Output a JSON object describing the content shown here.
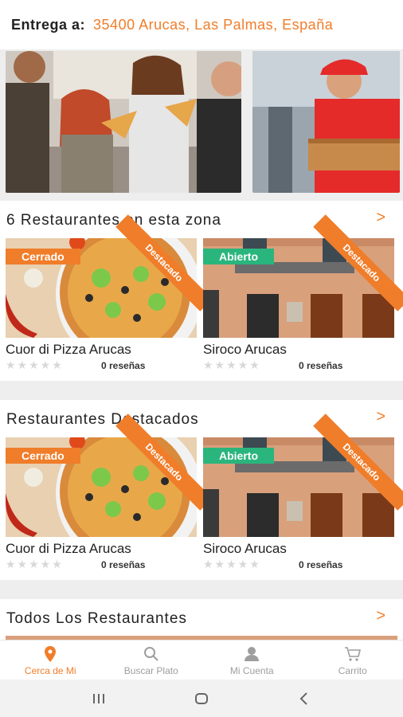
{
  "header": {
    "label": "Entrega a:",
    "address": "35400 Arucas, Las Palmas, España"
  },
  "banners": [
    {
      "icon": "friends-eating-pizza-photo"
    },
    {
      "icon": "pizza-delivery-man-photo"
    }
  ],
  "sections": [
    {
      "title": "6 Restaurantes en esta zona",
      "arrow": ">",
      "cards": [
        {
          "name": "Cuor di Pizza Arucas",
          "status": "Cerrado",
          "ribbon": "Destacado",
          "stars": "★★★★★",
          "reviews": "0 reseñas",
          "rating": 0
        },
        {
          "name": "Siroco Arucas",
          "status": "Abierto",
          "ribbon": "Destacado",
          "stars": "★★★★★",
          "reviews": "0 reseñas",
          "rating": 0
        }
      ]
    },
    {
      "title": "Restaurantes Destacados",
      "arrow": ">",
      "cards": [
        {
          "name": "Cuor di Pizza Arucas",
          "status": "Cerrado",
          "ribbon": "Destacado",
          "stars": "★★★★★",
          "reviews": "0 reseñas",
          "rating": 0
        },
        {
          "name": "Siroco Arucas",
          "status": "Abierto",
          "ribbon": "Destacado",
          "stars": "★★★★★",
          "reviews": "0 reseñas",
          "rating": 0
        }
      ]
    },
    {
      "title": "Todos Los Restaurantes",
      "arrow": ">"
    }
  ],
  "bottom_nav": [
    {
      "label": "Cerca de Mi",
      "icon": "location-pin-icon",
      "active": true
    },
    {
      "label": "Buscar Plato",
      "icon": "search-icon",
      "active": false
    },
    {
      "label": "Mi Cuenta",
      "icon": "user-icon",
      "active": false
    },
    {
      "label": "Carrito",
      "icon": "cart-icon",
      "active": false
    }
  ],
  "colors": {
    "accent": "#f07d2a",
    "open": "#2ab57d",
    "closed": "#f07d2a"
  }
}
